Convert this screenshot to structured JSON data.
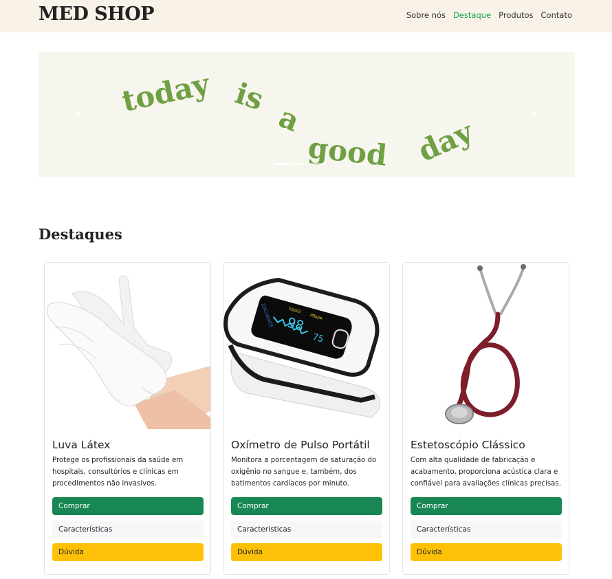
{
  "navbar": {
    "brand": "MED SHOP",
    "links": [
      "Sobre nós",
      "Destaque",
      "Produtos",
      "Contato"
    ],
    "active_link": "Destaque",
    "active_color": "#1aa34a",
    "background": "#f9f2e9"
  },
  "carousel": {
    "banner_words": [
      "today",
      "is",
      "a",
      "good",
      "day"
    ],
    "banner_color": "#6fa043",
    "prev_icon": "chevron-left-icon",
    "next_icon": "chevron-right-icon",
    "slide_count": 3,
    "active_slide": 1
  },
  "section": {
    "title": "Destaques"
  },
  "products": [
    {
      "title": "Luva Látex",
      "description": "Protege os profissionais da saúde em hospitais, consultórios e clínicas em procedimentos não invasivos.",
      "image": "latex-gloves-image",
      "buttons": {
        "buy": "Comprar",
        "features": "Características",
        "question": "Dúvida"
      }
    },
    {
      "title": "Oxímetro de Pulso Portátil",
      "description": "Monitora a porcentagem de saturação do oxigênio no sangue e, também, dos batimentos cardíacos por minuto.",
      "image": "pulse-oximeter-image",
      "display": {
        "spo2": "98",
        "pulse": "75",
        "label_spo2": "%SpO2",
        "label_pr": "PRbpm"
      },
      "buttons": {
        "buy": "Comprar",
        "features": "Características",
        "question": "Dúvida"
      }
    },
    {
      "title": "Estetoscópio Clássico",
      "description": "Com alta qualidade de fabricação e acabamento, proporciona acústica clara e confiável para avaliações clínicas precisas.",
      "image": "stethoscope-image",
      "buttons": {
        "buy": "Comprar",
        "features": "Características",
        "question": "Dúvida"
      }
    }
  ],
  "colors": {
    "buy": "#198754",
    "features": "#f6f7f8",
    "question": "#ffc107"
  }
}
